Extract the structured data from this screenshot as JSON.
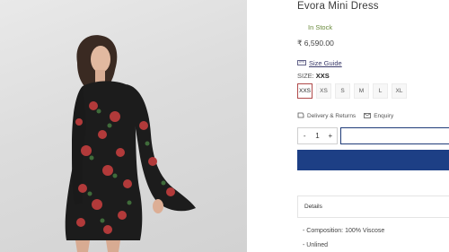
{
  "product": {
    "title": "Evora Mini Dress",
    "stock_status": "In Stock",
    "price": "₹ 6,590.00"
  },
  "size_guide": {
    "label": "Size Guide",
    "icon": "ruler-icon"
  },
  "size": {
    "label": "SIZE:",
    "selected": "XXS",
    "options": [
      "XXS",
      "XS",
      "S",
      "M",
      "L",
      "XL"
    ]
  },
  "links": {
    "delivery": "Delivery & Returns",
    "enquiry": "Enquiry"
  },
  "quantity": {
    "minus": "-",
    "value": "1",
    "plus": "+"
  },
  "details": {
    "header": "Details",
    "items": [
      "- Composition: 100% Viscose",
      "- Unlined"
    ]
  },
  "colors": {
    "accent": "#1d3f85",
    "stock": "#6a8a3c",
    "selected_border": "#b04a4a"
  }
}
